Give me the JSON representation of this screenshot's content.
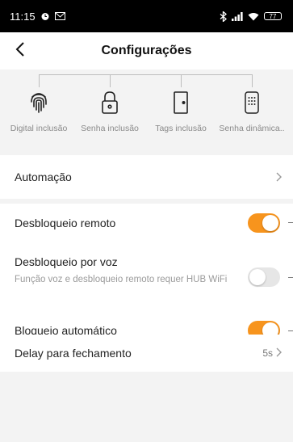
{
  "status_bar": {
    "time": "11:15",
    "battery": "77"
  },
  "header": {
    "title": "Configurações"
  },
  "methods": [
    {
      "label": "Digital inclusão",
      "icon": "fingerprint-icon"
    },
    {
      "label": "Senha inclusão",
      "icon": "padlock-icon"
    },
    {
      "label": "Tags inclusão",
      "icon": "door-icon"
    },
    {
      "label": "Senha dinâmica..",
      "icon": "keypad-icon"
    }
  ],
  "settings": {
    "automation": {
      "label": "Automação"
    },
    "remote_unlock": {
      "label": "Desbloqueio remoto",
      "enabled": true
    },
    "voice_unlock": {
      "label": "Desbloqueio por voz",
      "description": "Função voz e desbloqueio remoto requer HUB WiFi",
      "enabled": false
    },
    "auto_lock": {
      "label": "Bloqueio automático",
      "enabled": true
    },
    "close_delay": {
      "label": "Delay para fechamento",
      "value": "5s"
    }
  },
  "colors": {
    "accent": "#f7941d",
    "background": "#f3f3f3",
    "toggle_off": "#e6e6e6"
  }
}
